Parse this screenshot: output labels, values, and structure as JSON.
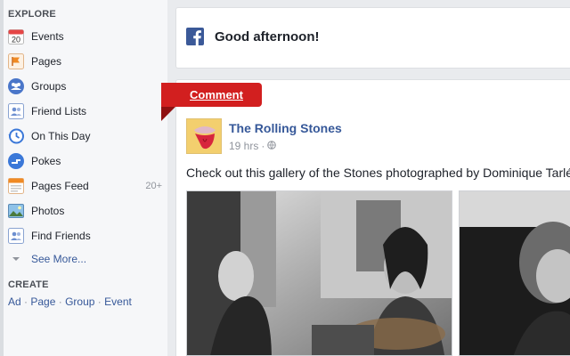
{
  "sidebar": {
    "explore_heading": "EXPLORE",
    "items": [
      {
        "label": "Events",
        "icon": "calendar-icon",
        "badge": "20"
      },
      {
        "label": "Pages",
        "icon": "flag-icon"
      },
      {
        "label": "Groups",
        "icon": "groups-icon"
      },
      {
        "label": "Friend Lists",
        "icon": "friend-list-icon"
      },
      {
        "label": "On This Day",
        "icon": "clock-icon"
      },
      {
        "label": "Pokes",
        "icon": "poke-icon"
      },
      {
        "label": "Pages Feed",
        "icon": "pages-feed-icon",
        "count": "20+"
      },
      {
        "label": "Photos",
        "icon": "photo-icon"
      },
      {
        "label": "Find Friends",
        "icon": "find-friends-icon"
      }
    ],
    "see_more": "See More...",
    "create_heading": "CREATE",
    "create_links": [
      "Ad",
      "Page",
      "Group",
      "Event"
    ],
    "separator": "·"
  },
  "greeting": {
    "text": "Good afternoon!",
    "icon": "facebook-logo-icon"
  },
  "comment_ribbon": {
    "label": "Comment"
  },
  "post": {
    "page_name": "The Rolling Stones",
    "time": "19 hrs",
    "separator": "·",
    "privacy_icon": "globe-icon",
    "avatar_icon": "rolling-stones-tongue-icon",
    "text": "Check out this gallery of the Stones photographed by Dominique Tarlé"
  },
  "colors": {
    "link_blue": "#365899",
    "facebook_blue": "#3b5998",
    "ribbon_red": "#d21f1f",
    "page_bg": "#e9ebee"
  }
}
